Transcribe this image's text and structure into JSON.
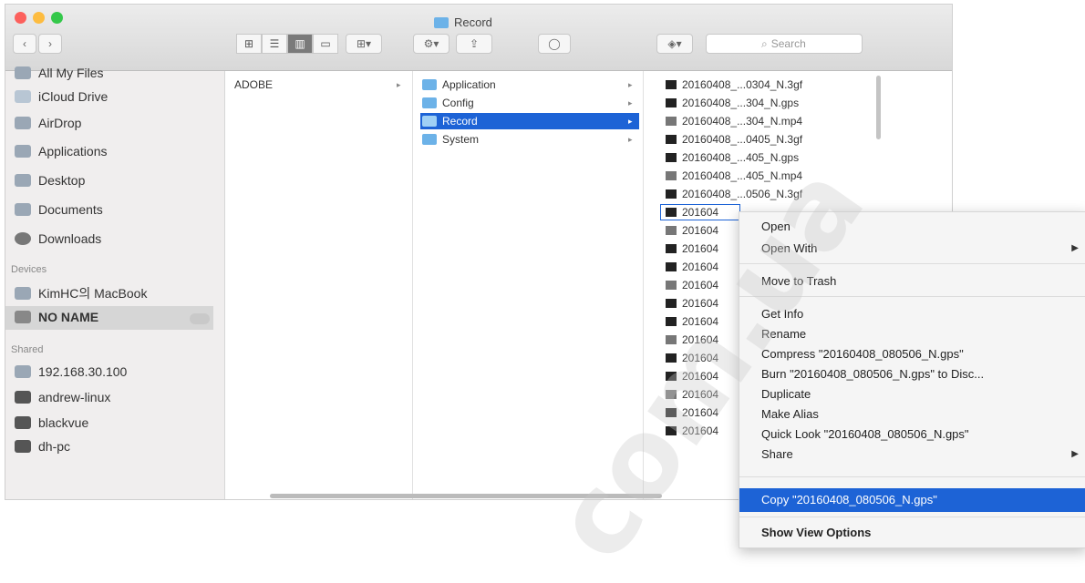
{
  "window": {
    "title": "Record"
  },
  "toolbar": {
    "search_placeholder": "Search"
  },
  "sidebar": {
    "favorites": [
      "All My Files",
      "iCloud Drive",
      "AirDrop",
      "Applications",
      "Desktop",
      "Documents",
      "Downloads"
    ],
    "devices_header": "Devices",
    "devices": [
      "KimHC의 MacBook",
      "NO NAME"
    ],
    "shared_header": "Shared",
    "shared": [
      "192.168.30.100",
      "andrew-linux",
      "blackvue",
      "dh-pc"
    ]
  },
  "column1": {
    "items": [
      "ADOBE"
    ]
  },
  "column2": {
    "items": [
      "Application",
      "Config",
      "Record",
      "System"
    ],
    "selected_index": 2
  },
  "column3": {
    "items": [
      "20160408_...0304_N.3gf",
      "20160408_...304_N.gps",
      "20160408_...304_N.mp4",
      "20160408_...0405_N.3gf",
      "20160408_...405_N.gps",
      "20160408_...405_N.mp4",
      "20160408_...0506_N.3gf",
      "201604",
      "201604",
      "201604",
      "201604",
      "201604",
      "201604",
      "201604",
      "201604",
      "201604",
      "201604",
      "201604",
      "201604",
      "201604"
    ]
  },
  "context_menu": {
    "open": "Open",
    "open_with": "Open With",
    "move_to_trash": "Move to Trash",
    "get_info": "Get Info",
    "rename": "Rename",
    "compress": "Compress \"20160408_080506_N.gps\"",
    "burn": "Burn \"20160408_080506_N.gps\" to Disc...",
    "duplicate": "Duplicate",
    "make_alias": "Make Alias",
    "quick_look": "Quick Look \"20160408_080506_N.gps\"",
    "share": "Share",
    "copy": "Copy \"20160408_080506_N.gps\"",
    "show_view_options": "Show View Options"
  },
  "watermark": {
    "text": "com.ua"
  },
  "colors": {
    "selection": "#1d63d6",
    "folder": "#6cb2e8"
  }
}
